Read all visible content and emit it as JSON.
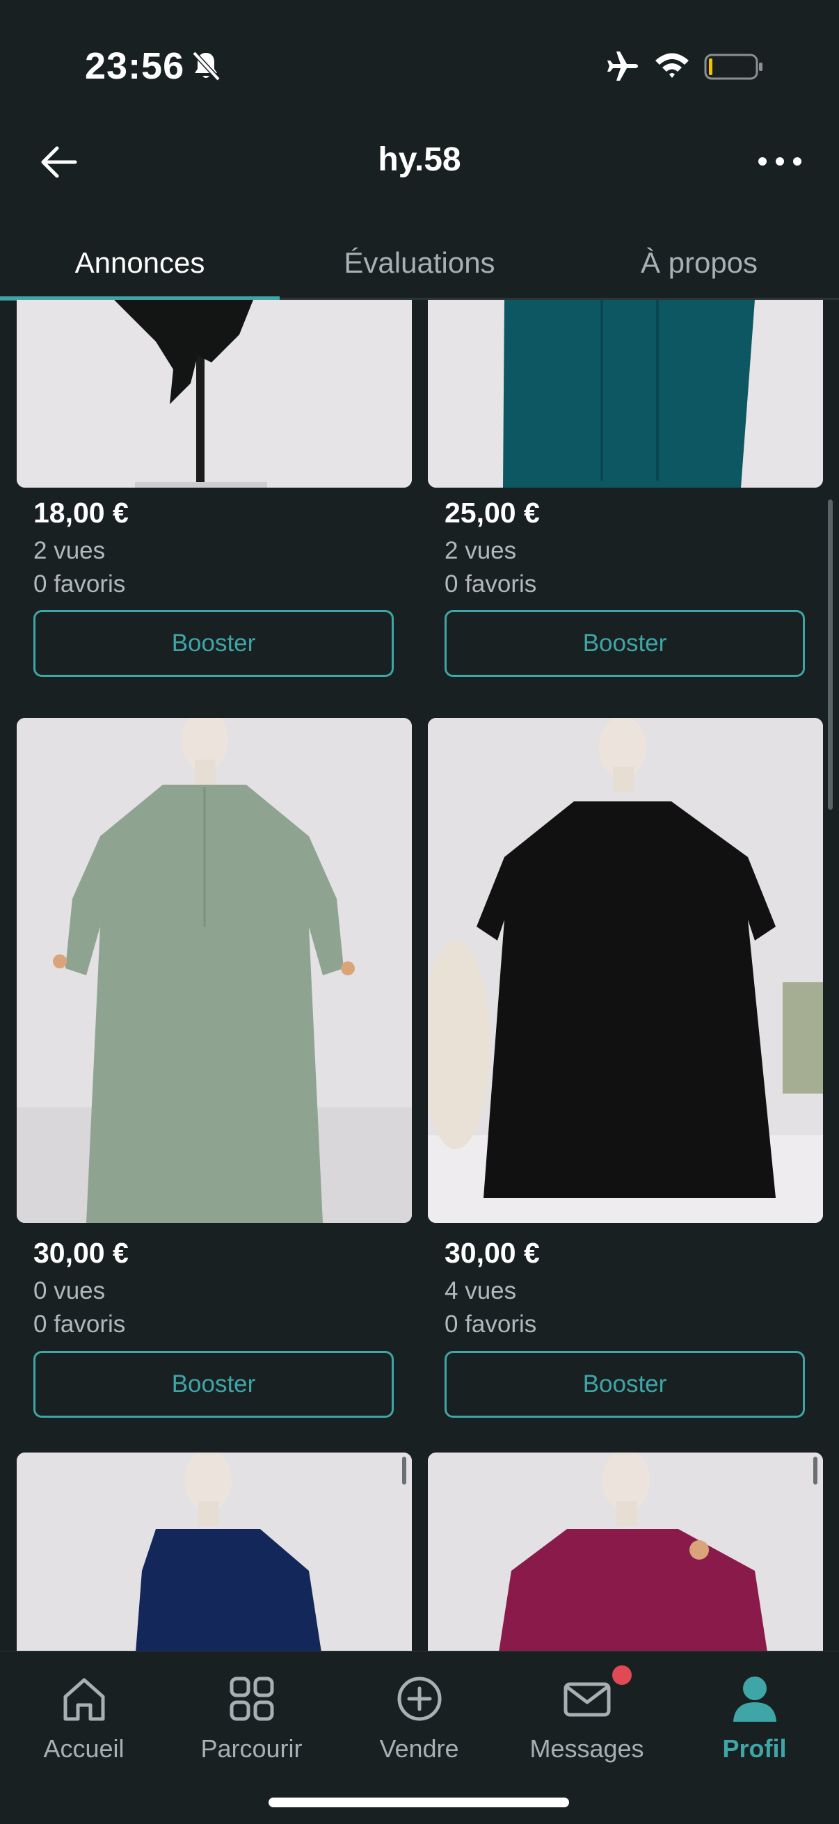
{
  "status_bar": {
    "time": "23:56"
  },
  "header": {
    "title": "hy.58"
  },
  "tabs": [
    {
      "label": "Annonces"
    },
    {
      "label": "Évaluations"
    },
    {
      "label": "À propos"
    }
  ],
  "listings": [
    {
      "price": "18,00 €",
      "views": "2 vues",
      "favorites": "0 favoris",
      "button": "Booster",
      "garment_color": "#131414"
    },
    {
      "price": "25,00 €",
      "views": "2 vues",
      "favorites": "0 favoris",
      "button": "Booster",
      "garment_color": "#0c5762"
    },
    {
      "price": "30,00 €",
      "views": "0 vues",
      "favorites": "0 favoris",
      "button": "Booster",
      "garment_color": "#8ea390"
    },
    {
      "price": "30,00 €",
      "views": "4 vues",
      "favorites": "0 favoris",
      "button": "Booster",
      "garment_color": "#111112"
    },
    {
      "garment_color": "#14275a"
    },
    {
      "garment_color": "#8a1a4a"
    }
  ],
  "bottom_nav": [
    {
      "label": "Accueil",
      "icon": "home-icon"
    },
    {
      "label": "Parcourir",
      "icon": "grid-icon"
    },
    {
      "label": "Vendre",
      "icon": "plus-circle-icon"
    },
    {
      "label": "Messages",
      "icon": "mail-icon"
    },
    {
      "label": "Profil",
      "icon": "person-icon"
    }
  ],
  "colors": {
    "accent": "#3fa6a8",
    "background": "#192022",
    "notification": "#e14a55"
  }
}
